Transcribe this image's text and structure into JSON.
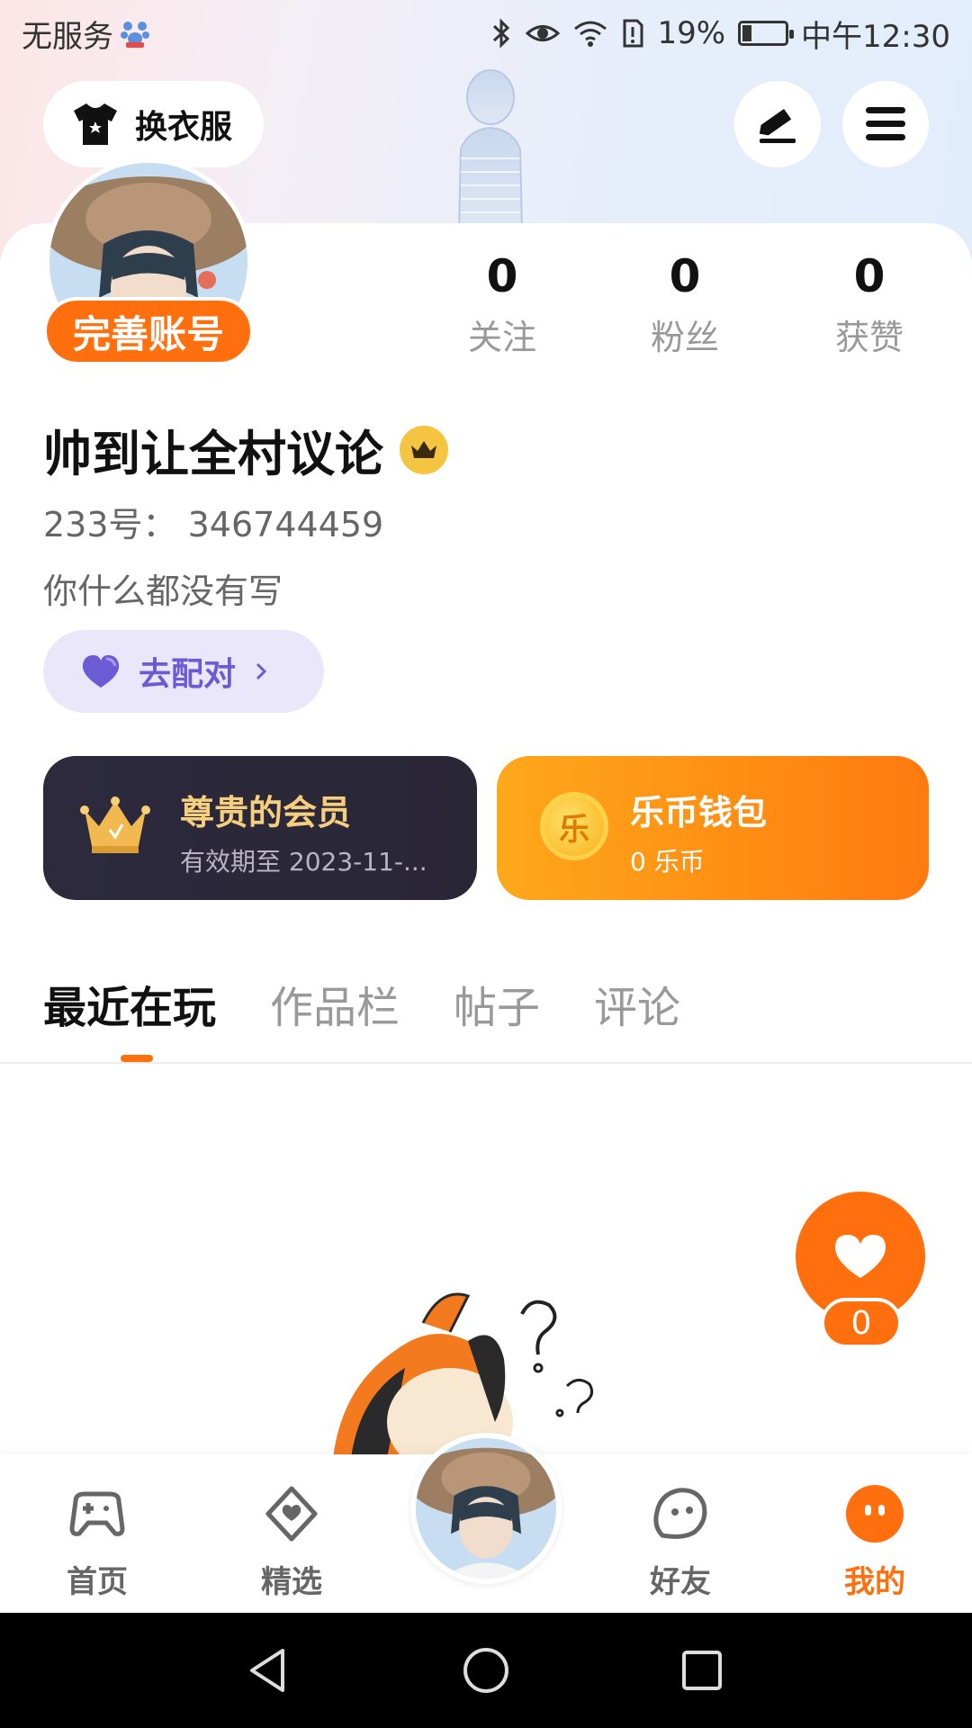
{
  "status_bar": {
    "carrier": "无服务",
    "battery": "19%",
    "time": "中午12:30"
  },
  "header": {
    "wardrobe_label": "换衣服"
  },
  "profile": {
    "complete_account": "完善账号",
    "stats": [
      {
        "value": "0",
        "label": "关注"
      },
      {
        "value": "0",
        "label": "粉丝"
      },
      {
        "value": "0",
        "label": "获赞"
      }
    ],
    "username": "帅到让全村议论",
    "user_id": "233号： 346744459",
    "bio": "你什么都没有写",
    "match_label": "去配对"
  },
  "cards": {
    "vip": {
      "title": "尊贵的会员",
      "subtitle": "有效期至 2023-11-..."
    },
    "wallet": {
      "coin_char": "乐",
      "title": "乐币钱包",
      "subtitle": "0 乐币"
    }
  },
  "tabs": [
    {
      "label": "最近在玩",
      "active": true
    },
    {
      "label": "作品栏",
      "active": false
    },
    {
      "label": "帖子",
      "active": false
    },
    {
      "label": "评论",
      "active": false
    }
  ],
  "floating_like": {
    "count": "0"
  },
  "bottom_nav": [
    {
      "label": "首页",
      "icon": "gamepad-icon"
    },
    {
      "label": "精选",
      "icon": "heart-chat-icon"
    },
    {
      "label": "好友",
      "icon": "friend-face-icon"
    },
    {
      "label": "我的",
      "icon": "mine-face-icon",
      "active": true
    }
  ],
  "colors": {
    "accent": "#ff6f0d",
    "vip_gold": "#f6cf7e",
    "match_purple": "#6b5cd6"
  }
}
